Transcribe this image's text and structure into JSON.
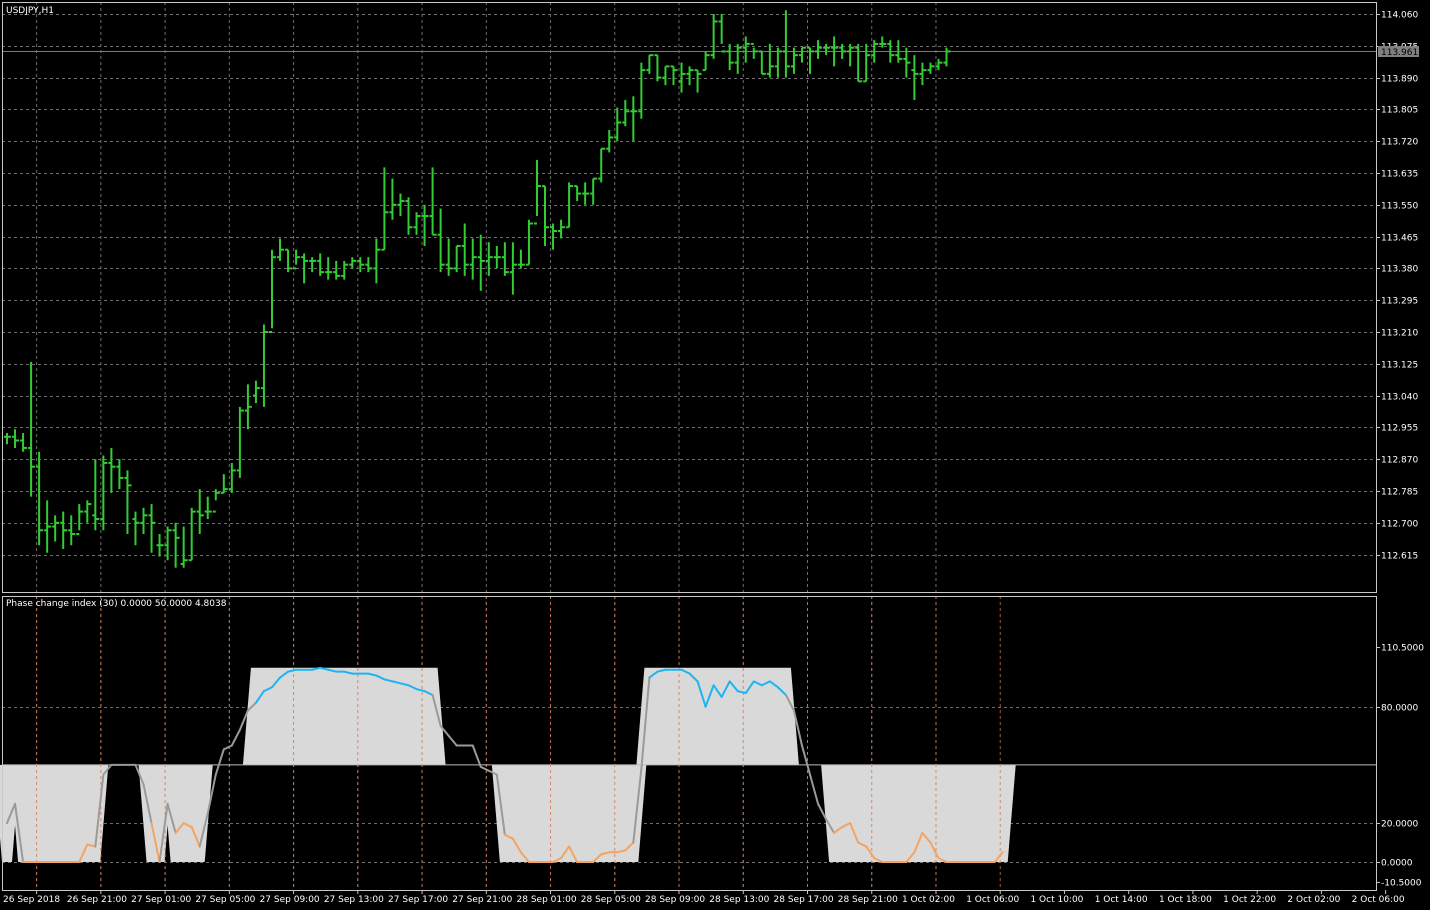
{
  "window": {
    "title": "USDJPY,H1"
  },
  "indicator": {
    "title": "Phase change index (30) 0.0000 50.0000 4.8038"
  },
  "current_price_label": "113.961",
  "colors": {
    "background": "#000000",
    "grid": "#6e6e6e",
    "bars": "#32cd32",
    "frame": "#c8c8c8",
    "fill": "#d9d9d9",
    "line_mid": "#9a9a9a",
    "line_high": "#1eb4f0",
    "line_low": "#f4a460",
    "dash": "#c87850",
    "price_line": "#7a7a7a"
  },
  "chart_data": [
    {
      "type": "ohlc",
      "symbol": "USDJPY",
      "timeframe": "H1",
      "ylim": [
        12.57,
        114.075
      ],
      "y_ticks": [
        "114.060",
        "113.975",
        "113.890",
        "113.805",
        "113.720",
        "113.635",
        "113.550",
        "113.465",
        "113.380",
        "113.295",
        "113.210",
        "113.125",
        "113.040",
        "112.955",
        "112.870",
        "112.785",
        "112.700",
        "112.615"
      ],
      "x_ticks": [
        "26 Sep 2018",
        "26 Sep 21:00",
        "27 Sep 01:00",
        "27 Sep 05:00",
        "27 Sep 09:00",
        "27 Sep 13:00",
        "27 Sep 17:00",
        "27 Sep 21:00",
        "28 Sep 01:00",
        "28 Sep 05:00",
        "28 Sep 09:00",
        "28 Sep 13:00",
        "28 Sep 17:00",
        "28 Sep 21:00",
        "1 Oct 02:00",
        "1 Oct 06:00",
        "1 Oct 10:00",
        "1 Oct 14:00",
        "1 Oct 18:00",
        "1 Oct 22:00",
        "2 Oct 02:00",
        "2 Oct 06:00"
      ],
      "current_price": 113.961,
      "ohlc": [
        [
          112.93,
          112.94,
          112.91,
          112.93
        ],
        [
          112.93,
          112.95,
          112.9,
          112.92
        ],
        [
          112.92,
          112.94,
          112.89,
          112.9
        ],
        [
          112.9,
          113.13,
          112.77,
          112.85
        ],
        [
          112.85,
          112.89,
          112.64,
          112.68
        ],
        [
          112.68,
          112.76,
          112.62,
          112.69
        ],
        [
          112.69,
          112.72,
          112.65,
          112.7
        ],
        [
          112.7,
          112.73,
          112.63,
          112.68
        ],
        [
          112.68,
          112.72,
          112.64,
          112.67
        ],
        [
          112.67,
          112.75,
          112.68,
          112.73
        ],
        [
          112.73,
          112.76,
          112.7,
          112.75
        ],
        [
          112.72,
          112.87,
          112.68,
          112.71
        ],
        [
          112.71,
          112.88,
          112.68,
          112.86
        ],
        [
          112.86,
          112.9,
          112.78,
          112.85
        ],
        [
          112.85,
          112.87,
          112.79,
          112.82
        ],
        [
          112.82,
          112.84,
          112.67,
          112.8
        ],
        [
          112.71,
          112.73,
          112.64,
          112.7
        ],
        [
          112.7,
          112.74,
          112.67,
          112.72
        ],
        [
          112.72,
          112.75,
          112.62,
          112.7
        ],
        [
          112.64,
          112.67,
          112.61,
          112.64
        ],
        [
          112.64,
          112.69,
          112.6,
          112.68
        ],
        [
          112.68,
          112.7,
          112.58,
          112.66
        ],
        [
          112.59,
          112.69,
          112.58,
          112.6
        ],
        [
          112.6,
          112.74,
          112.6,
          112.73
        ],
        [
          112.73,
          112.79,
          112.67,
          112.72
        ],
        [
          112.73,
          112.77,
          112.71,
          112.73
        ],
        [
          112.73,
          112.79,
          112.76,
          112.78
        ],
        [
          112.78,
          112.83,
          112.78,
          112.79
        ],
        [
          112.79,
          112.86,
          112.78,
          112.84
        ],
        [
          112.84,
          113.01,
          112.82,
          113.0
        ],
        [
          113.0,
          113.07,
          112.95,
          113.01
        ],
        [
          113.04,
          113.08,
          113.02,
          113.06
        ],
        [
          113.06,
          113.23,
          113.01,
          113.21
        ],
        [
          113.21,
          113.43,
          113.22,
          113.41
        ],
        [
          113.41,
          113.46,
          113.4,
          113.43
        ],
        [
          113.43,
          113.43,
          113.37,
          113.38
        ],
        [
          113.38,
          113.43,
          113.39,
          113.41
        ],
        [
          113.41,
          113.42,
          113.34,
          113.4
        ],
        [
          113.4,
          113.41,
          113.37,
          113.4
        ],
        [
          113.4,
          113.42,
          113.36,
          113.37
        ],
        [
          113.37,
          113.41,
          113.35,
          113.37
        ],
        [
          113.37,
          113.4,
          113.35,
          113.36
        ],
        [
          113.36,
          113.4,
          113.35,
          113.39
        ],
        [
          113.39,
          113.41,
          113.38,
          113.4
        ],
        [
          113.4,
          113.41,
          113.37,
          113.39
        ],
        [
          113.39,
          113.41,
          113.37,
          113.38
        ],
        [
          113.38,
          113.46,
          113.34,
          113.43
        ],
        [
          113.43,
          113.65,
          113.43,
          113.53
        ],
        [
          113.53,
          113.62,
          113.51,
          113.55
        ],
        [
          113.55,
          113.58,
          113.52,
          113.56
        ],
        [
          113.56,
          113.57,
          113.47,
          113.49
        ],
        [
          113.49,
          113.53,
          113.47,
          113.52
        ],
        [
          113.52,
          113.55,
          113.44,
          113.52
        ],
        [
          113.52,
          113.65,
          113.47,
          113.47
        ],
        [
          113.47,
          113.54,
          113.37,
          113.39
        ],
        [
          113.39,
          113.46,
          113.36,
          113.38
        ],
        [
          113.38,
          113.44,
          113.37,
          113.44
        ],
        [
          113.44,
          113.5,
          113.36,
          113.39
        ],
        [
          113.39,
          113.46,
          113.35,
          113.41
        ],
        [
          113.41,
          113.47,
          113.32,
          113.4
        ],
        [
          113.4,
          113.45,
          113.36,
          113.41
        ],
        [
          113.41,
          113.44,
          113.38,
          113.41
        ],
        [
          113.41,
          113.45,
          113.36,
          113.37
        ],
        [
          113.37,
          113.45,
          113.31,
          113.39
        ],
        [
          113.39,
          113.43,
          113.38,
          113.39
        ],
        [
          113.39,
          113.51,
          113.39,
          113.5
        ],
        [
          113.5,
          113.67,
          113.52,
          113.6
        ],
        [
          113.6,
          113.6,
          113.44,
          113.49
        ],
        [
          113.49,
          113.5,
          113.43,
          113.48
        ],
        [
          113.48,
          113.51,
          113.46,
          113.49
        ],
        [
          113.49,
          113.61,
          113.49,
          113.6
        ],
        [
          113.6,
          113.6,
          113.56,
          113.58
        ],
        [
          113.58,
          113.61,
          113.55,
          113.58
        ],
        [
          113.58,
          113.62,
          113.55,
          113.62
        ],
        [
          113.62,
          113.7,
          113.61,
          113.7
        ],
        [
          113.7,
          113.75,
          113.69,
          113.73
        ],
        [
          113.73,
          113.81,
          113.72,
          113.77
        ],
        [
          113.77,
          113.83,
          113.76,
          113.8
        ],
        [
          113.8,
          113.84,
          113.72,
          113.8
        ],
        [
          113.8,
          113.93,
          113.78,
          113.91
        ],
        [
          113.91,
          113.95,
          113.9,
          113.95
        ],
        [
          113.95,
          113.95,
          113.88,
          113.89
        ],
        [
          113.89,
          113.92,
          113.87,
          113.92
        ],
        [
          113.92,
          113.92,
          113.87,
          113.91
        ],
        [
          113.88,
          113.93,
          113.85,
          113.9
        ],
        [
          113.9,
          113.92,
          113.87,
          113.91
        ],
        [
          113.91,
          113.91,
          113.85,
          113.9
        ],
        [
          113.91,
          113.96,
          113.91,
          113.95
        ],
        [
          113.95,
          114.06,
          113.94,
          114.04
        ],
        [
          114.04,
          114.06,
          113.98,
          113.96
        ],
        [
          113.96,
          113.98,
          113.91,
          113.93
        ],
        [
          113.93,
          113.98,
          113.9,
          113.97
        ],
        [
          113.97,
          114.0,
          113.93,
          113.98
        ],
        [
          113.98,
          113.97,
          113.94,
          113.96
        ],
        [
          113.96,
          113.96,
          113.9,
          113.9
        ],
        [
          113.9,
          113.98,
          113.89,
          113.92
        ],
        [
          113.92,
          113.97,
          113.89,
          113.96
        ],
        [
          113.96,
          114.07,
          113.89,
          113.92
        ],
        [
          113.92,
          113.97,
          113.9,
          113.95
        ],
        [
          113.95,
          113.97,
          113.93,
          113.97
        ],
        [
          113.97,
          113.97,
          113.9,
          113.96
        ],
        [
          113.96,
          113.99,
          113.94,
          113.97
        ],
        [
          113.97,
          113.98,
          113.95,
          113.97
        ],
        [
          113.97,
          114.0,
          113.92,
          113.97
        ],
        [
          113.97,
          113.98,
          113.94,
          113.96
        ],
        [
          113.96,
          113.98,
          113.92,
          113.97
        ],
        [
          113.97,
          113.98,
          113.88,
          113.88
        ],
        [
          113.88,
          113.98,
          113.88,
          113.95
        ],
        [
          113.95,
          113.99,
          113.93,
          113.98
        ],
        [
          113.98,
          114.0,
          113.97,
          113.98
        ],
        [
          113.98,
          113.99,
          113.93,
          113.95
        ],
        [
          113.95,
          113.99,
          113.93,
          113.94
        ],
        [
          113.94,
          113.97,
          113.89,
          113.93
        ],
        [
          113.91,
          113.95,
          113.83,
          113.9
        ],
        [
          113.9,
          113.93,
          113.87,
          113.91
        ],
        [
          113.91,
          113.93,
          113.9,
          113.92
        ],
        [
          113.92,
          113.94,
          113.91,
          113.93
        ],
        [
          113.93,
          113.97,
          113.92,
          113.96
        ]
      ]
    },
    {
      "type": "line",
      "name": "Phase change index (30)",
      "ylim": [
        -10.5,
        110.5
      ],
      "y_ticks": [
        "110.5000",
        "80.0000",
        "20.0000",
        "0.0000",
        "-10.5000"
      ],
      "levels": [
        0,
        50,
        100
      ],
      "values": [
        20,
        30,
        0,
        0,
        0,
        0,
        0,
        0,
        0,
        0,
        9,
        8,
        45,
        50,
        50,
        50,
        50,
        40,
        20,
        0,
        30,
        15,
        20,
        18,
        8,
        25,
        45,
        58,
        60,
        68,
        78,
        82,
        88,
        90,
        95,
        98,
        99,
        99,
        99,
        100,
        99,
        98,
        98,
        97,
        97,
        97,
        96,
        94,
        93,
        92,
        91,
        89,
        88,
        86,
        70,
        65,
        60,
        60,
        60,
        49,
        47,
        45,
        14,
        12,
        5,
        0,
        0,
        0,
        0,
        2,
        8,
        0,
        0,
        0,
        4,
        5,
        5,
        6,
        10,
        48,
        95,
        98,
        99,
        99,
        99,
        97,
        93,
        80,
        91,
        85,
        93,
        88,
        87,
        93,
        91,
        93,
        90,
        86,
        78,
        60,
        45,
        30,
        22,
        15,
        18,
        20,
        10,
        8,
        2,
        0,
        0,
        0,
        0,
        5,
        15,
        10,
        2,
        0,
        0,
        0,
        0,
        0,
        0,
        0,
        5
      ]
    }
  ]
}
